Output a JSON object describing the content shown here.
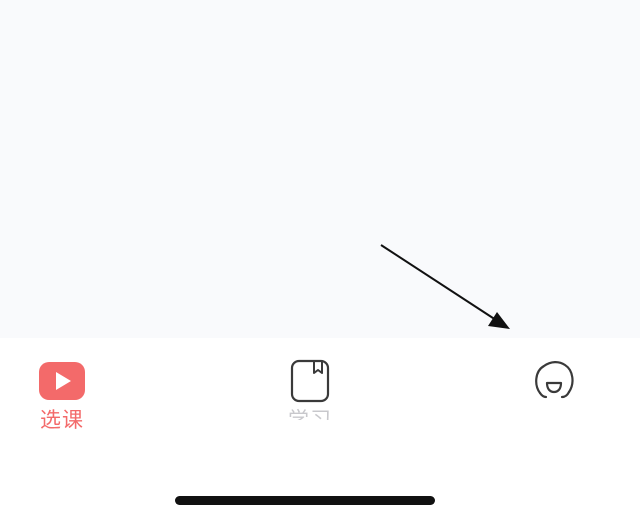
{
  "tab_bar": {
    "tabs": [
      {
        "label": "选课",
        "icon": "play-icon",
        "active": true
      },
      {
        "label": "学习",
        "icon": "notebook-icon",
        "active": false
      },
      {
        "label": "",
        "icon": "face-icon",
        "active": false
      }
    ]
  },
  "colors": {
    "accent": "#f36a6a",
    "content_background": "#f9fafc",
    "tab_bar_background": "#ffffff",
    "icon_stroke": "#3a3a3a",
    "home_indicator": "#111111"
  }
}
